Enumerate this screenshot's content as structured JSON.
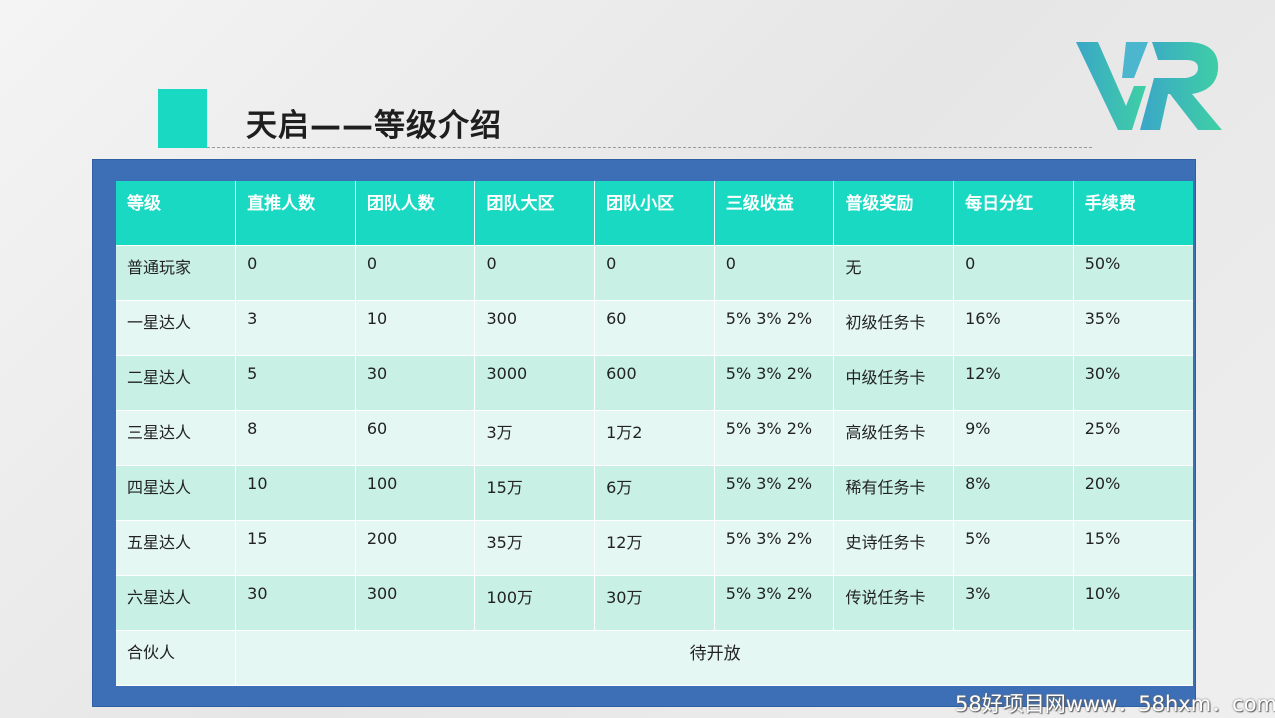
{
  "slide": {
    "title": "天启——等级介绍",
    "logo_text": "VR",
    "accent_color": "#1ad9c2",
    "panel_color": "#3d6fb6"
  },
  "table": {
    "headers": [
      "等级",
      "直推人数",
      "团队人数",
      "团队大区",
      "团队小区",
      "三级收益",
      "普级奖励",
      "每日分红",
      "手续费"
    ],
    "rows": [
      [
        "普通玩家",
        "0",
        "0",
        "0",
        "0",
        "0",
        "无",
        "0",
        "50%"
      ],
      [
        "一星达人",
        "3",
        "10",
        "300",
        "60",
        "5% 3% 2%",
        "初级任务卡",
        "16%",
        "35%"
      ],
      [
        "二星达人",
        "5",
        "30",
        "3000",
        "600",
        "5% 3% 2%",
        "中级任务卡",
        "12%",
        "30%"
      ],
      [
        "三星达人",
        "8",
        "60",
        "3万",
        "1万2",
        "5% 3% 2%",
        "高级任务卡",
        "9%",
        "25%"
      ],
      [
        "四星达人",
        "10",
        "100",
        "15万",
        "6万",
        "5% 3% 2%",
        "稀有任务卡",
        "8%",
        "20%"
      ],
      [
        "五星达人",
        "15",
        "200",
        "35万",
        "12万",
        "5% 3% 2%",
        "史诗任务卡",
        "5%",
        "15%"
      ],
      [
        "六星达人",
        "30",
        "300",
        "100万",
        "30万",
        "5% 3% 2%",
        "传说任务卡",
        "3%",
        "10%"
      ]
    ],
    "last_row": {
      "level": "合伙人",
      "note": "待开放"
    }
  },
  "watermark": "58好项目网www．58hxm．com"
}
